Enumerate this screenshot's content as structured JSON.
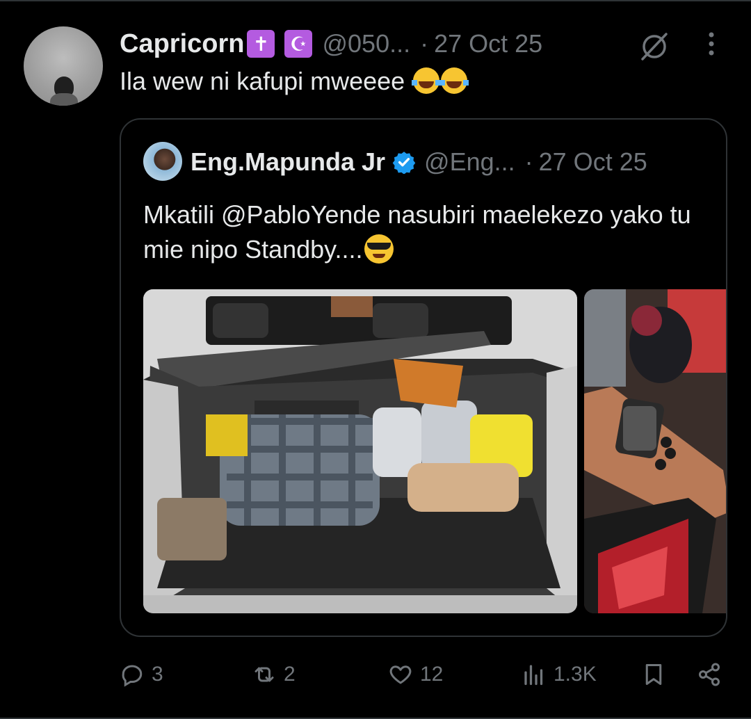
{
  "post": {
    "author_name": "Capricorn",
    "author_emoji_1": "✝",
    "author_emoji_2": "☪",
    "handle": "@050...",
    "separator": "·",
    "date": "27 Oct 25",
    "text": "Ila wew ni kafupi mweeee",
    "text_icons": [
      "face-with-tears-of-joy-icon",
      "face-with-tears-of-joy-icon"
    ]
  },
  "quote": {
    "author_name": "Eng.Mapunda Jr",
    "verified": true,
    "handle": "@Eng...",
    "separator": "·",
    "date": "27 Oct 25",
    "text": "Mkatili @PabloYende nasubiri maelekezo yako tu mie nipo Standby....",
    "text_icon": "smiling-face-with-sunglasses-icon",
    "media": [
      "car-trunk-with-bags-and-shoes-photo",
      "wrist-with-watch-at-car-photo"
    ]
  },
  "actions": {
    "replies": "3",
    "reposts": "2",
    "likes": "12",
    "views": "1.3K"
  },
  "colors": {
    "background": "#000000",
    "text": "#e7e9ea",
    "muted": "#71767b",
    "border": "#2f3336",
    "verified": "#1d9bf0"
  }
}
